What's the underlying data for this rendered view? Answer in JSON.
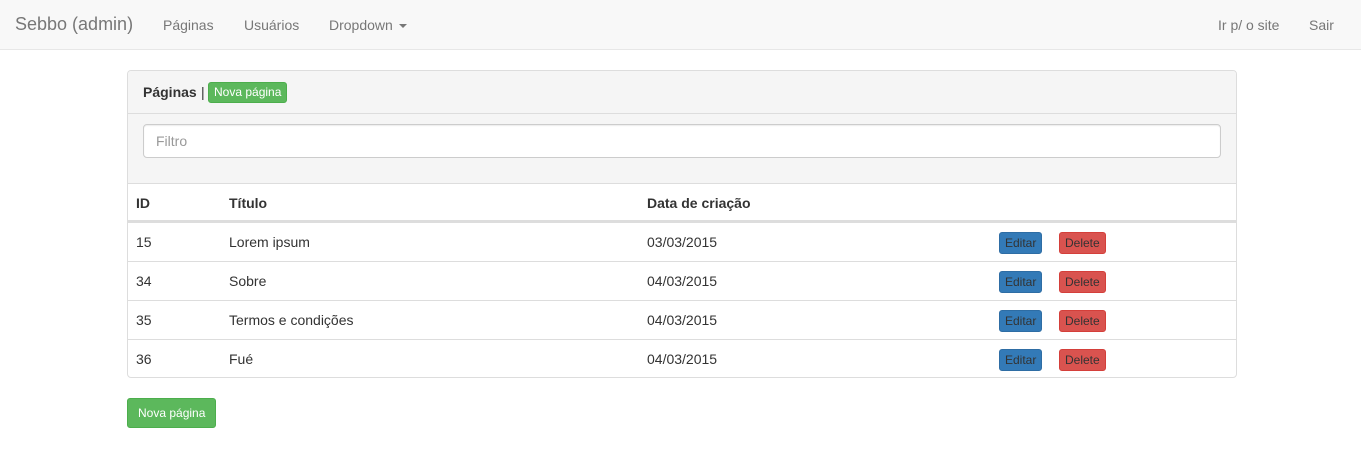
{
  "navbar": {
    "brand": "Sebbo (admin)",
    "links": [
      "Páginas",
      "Usuários",
      "Dropdown"
    ],
    "right_links": [
      "Ir p/ o site",
      "Sair"
    ]
  },
  "panel": {
    "title": "Páginas",
    "separator": "|",
    "new_page_label": "Nova página",
    "filter_placeholder": "Filtro"
  },
  "table": {
    "columns": [
      "ID",
      "Título",
      "Data de criação"
    ],
    "rows": [
      {
        "id": "15",
        "title": "Lorem ipsum",
        "date": "03/03/2015"
      },
      {
        "id": "34",
        "title": "Sobre",
        "date": "04/03/2015"
      },
      {
        "id": "35",
        "title": "Termos e condições",
        "date": "04/03/2015"
      },
      {
        "id": "36",
        "title": "Fué",
        "date": "04/03/2015"
      }
    ],
    "edit_label": "Editar",
    "delete_label": "Delete"
  },
  "footer": {
    "new_page_label": "Nova página"
  },
  "colors": {
    "success": "#5cb85c",
    "primary": "#337ab7",
    "danger": "#d9534f",
    "navbar_bg": "#f8f8f8"
  },
  "icons": {
    "dropdown": "caret-down-icon"
  }
}
